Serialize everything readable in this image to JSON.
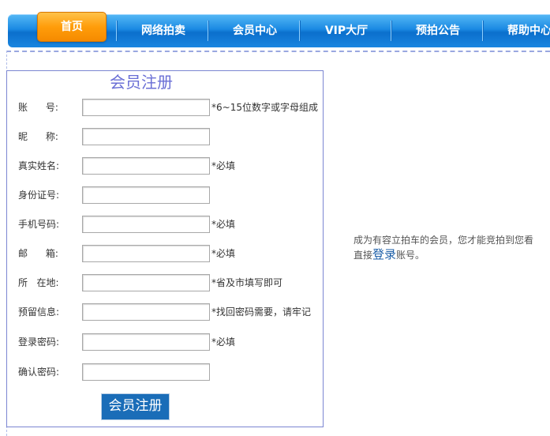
{
  "nav": {
    "home": "首页",
    "items": [
      {
        "label": "网络拍卖"
      },
      {
        "label": "会员中心"
      },
      {
        "label": "VIP大厅"
      },
      {
        "label": "预拍公告"
      },
      {
        "label": "帮助中心"
      }
    ]
  },
  "register": {
    "title": "会员注册",
    "fields": [
      {
        "label": "账      号:",
        "value": "",
        "hint": "*6~15位数字或字母组成"
      },
      {
        "label": "昵      称:",
        "value": "",
        "hint": ""
      },
      {
        "label": "真实姓名:",
        "value": "",
        "hint": "*必填"
      },
      {
        "label": "身份证号:",
        "value": "",
        "hint": ""
      },
      {
        "label": "手机号码:",
        "value": "",
        "hint": "*必填"
      },
      {
        "label": "邮      箱:",
        "value": "",
        "hint": "*必填"
      },
      {
        "label": "所   在地:",
        "value": "",
        "hint": "*省及市填写即可"
      },
      {
        "label": "预留信息:",
        "value": "",
        "hint": "*找回密码需要，请牢记"
      },
      {
        "label": "登录密码:",
        "value": "",
        "hint": "*必填"
      },
      {
        "label": "确认密码:",
        "value": "",
        "hint": ""
      }
    ],
    "submit_label": "会员注册"
  },
  "side": {
    "line1": "成为有容立拍车的会员，您才能竞拍到您看",
    "line2_prefix": "直接",
    "login_link": "登录",
    "line2_suffix": "账号。"
  },
  "colors": {
    "nav_blue": "#1b8ae3",
    "home_orange": "#ff9d0a",
    "title_purple": "#6a6fd6",
    "button_blue": "#1a6db8"
  }
}
